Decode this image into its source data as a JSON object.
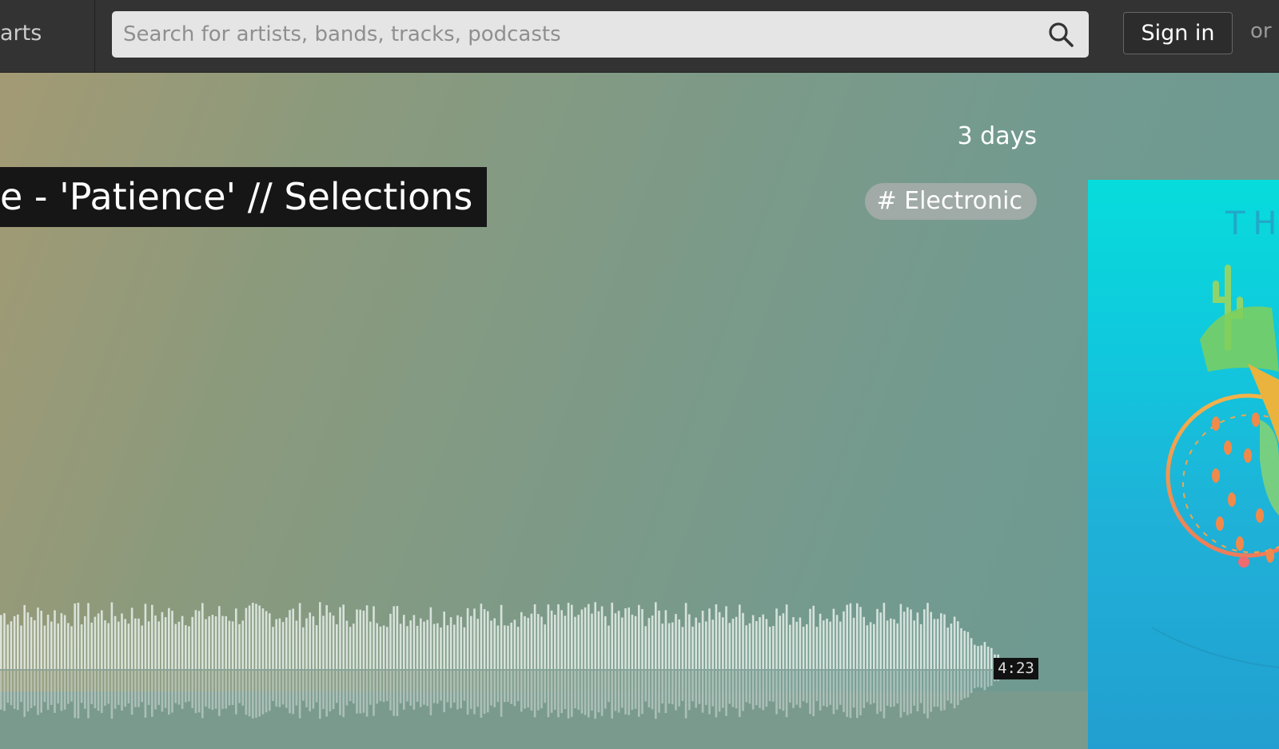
{
  "header": {
    "nav_partial_label": "arts",
    "search": {
      "placeholder": "Search for artists, bands, tracks, podcasts",
      "value": ""
    },
    "sign_in_label": "Sign in",
    "or_label": "or"
  },
  "track": {
    "posted": "3 days",
    "title": "e - 'Patience' // Selections",
    "tag": "# Electronic",
    "duration": "4:23",
    "progress": 0
  },
  "artwork": {
    "text_fragment": "TH",
    "colors": {
      "top": "#07dcdc",
      "bottom": "#229fd0",
      "accent": "#f08a4b"
    }
  },
  "colors": {
    "topbar": "#333333",
    "hero_left": "#a39a74",
    "hero_right": "#6a9a93",
    "waveform": "#e6eeea"
  }
}
